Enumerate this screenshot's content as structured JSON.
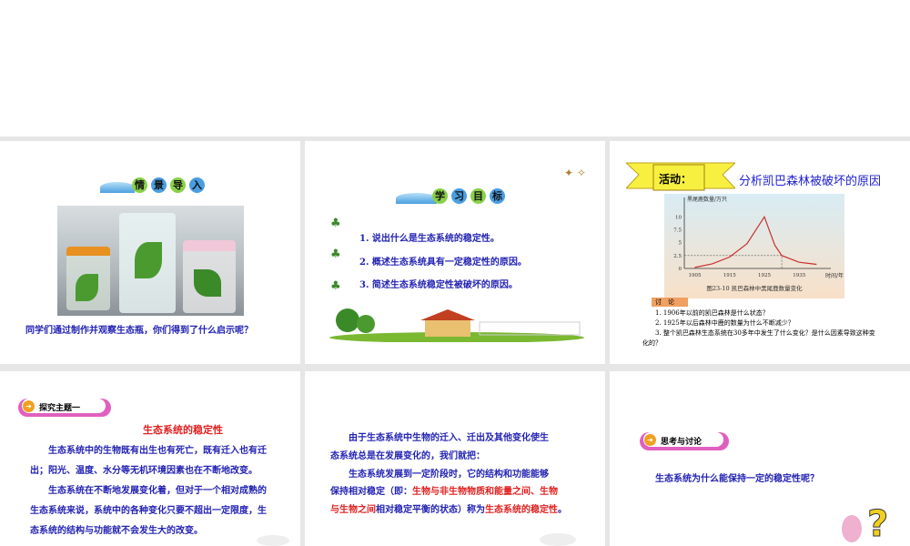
{
  "slide1": {
    "title_chars": [
      "情",
      "景",
      "导",
      "入"
    ],
    "caption": "同学们通过制作并观察生态瓶，你们得到了什么启示呢？"
  },
  "slide2": {
    "title_chars": [
      "学",
      "习",
      "目",
      "标"
    ],
    "items": [
      "1. 说出什么是生态系统的稳定性。",
      "2. 概述生态系统具有一定稳定性的原因。",
      "3. 简述生态系统稳定性被破坏的原因。"
    ]
  },
  "slide3": {
    "badge": "活动：",
    "title": "分析凯巴森林被破坏的原因",
    "discuss_label": "讨　论",
    "questions": [
      "1. 1906年以前的凯巴森林是什么状态？",
      "2. 1925年以后森林中鹿的数量为什么不断减少？",
      "3. 整个凯巴森林生态系统在30多年中发生了什么变化？是什么因素导致这种变化的？"
    ]
  },
  "chart_data": {
    "type": "line",
    "title": "图23-10 凯巴森林中黑尾鹿数量变化",
    "ylabel": "黑尾鹿数量/万只",
    "xlabel": "时间/年",
    "x": [
      1905,
      1910,
      1915,
      1920,
      1925,
      1928,
      1930,
      1935,
      1940
    ],
    "values": [
      0.2,
      0.9,
      2.2,
      4.8,
      10,
      4.5,
      2.5,
      1.2,
      0.8
    ],
    "xticks": [
      "1905",
      "1915",
      "1925",
      "1935"
    ],
    "yticks": [
      "0",
      "2.5",
      "5",
      "7.5",
      "10"
    ],
    "xlim": [
      1902,
      1942
    ],
    "ylim": [
      0,
      12
    ],
    "reference_y": 2.5,
    "reference_x": 1930
  },
  "slide4": {
    "header": "探究主题一",
    "title": "生态系统的稳定性",
    "lines": [
      "　　生态系统中的生物既有出生也有死亡，既有迁入也有迁",
      "出；阳光、温度、水分等无机环境因素也在不断地改变。",
      "　　生态系统在不断地发展变化着，但对于一个相对成熟的",
      "生态系统来说，系统中的各种变化只要不超出一定限度，生",
      "态系统的结构与功能就不会发生大的改变。"
    ]
  },
  "slide5": {
    "l1": "　　由于生态系统中生物的迁入、迁出及其他变化使生",
    "l2": "态系统总是在发展变化的，我们就把：",
    "l3": "　　生态系统发展到一定阶段时，它的结构和功能能够",
    "l4a": "保持相对稳定（即：",
    "l4b": "生物与非生物物质和能量之间、生物",
    "l5a": "与生物之间",
    "l5b": "相对稳定平衡的状态）称为",
    "l5c": "生态系统的稳定性",
    "l5d": "。"
  },
  "slide6": {
    "header": "思考与讨论",
    "question": "生态系统为什么能保持一定的稳定性呢？"
  }
}
